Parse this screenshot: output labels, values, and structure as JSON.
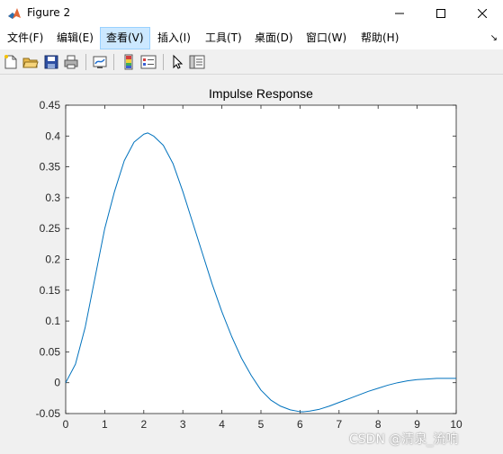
{
  "window": {
    "title": "Figure 2"
  },
  "menu": {
    "items": [
      {
        "label": "文件(F)"
      },
      {
        "label": "编辑(E)"
      },
      {
        "label": "查看(V)"
      },
      {
        "label": "插入(I)"
      },
      {
        "label": "工具(T)"
      },
      {
        "label": "桌面(D)"
      },
      {
        "label": "窗口(W)"
      },
      {
        "label": "帮助(H)"
      }
    ],
    "active_index": 2
  },
  "toolbar": {
    "icons": [
      "new-figure-icon",
      "open-file-icon",
      "save-icon",
      "print-icon",
      "link-plot-icon",
      "colorbar-icon",
      "legend-icon",
      "pointer-icon",
      "property-inspector-icon"
    ]
  },
  "colors": {
    "line": "#0072bd",
    "axes_bg": "#ffffff",
    "figure_bg": "#f0f0f0"
  },
  "watermark": "CSDN @清泉_流响",
  "chart_data": {
    "type": "line",
    "title": "Impulse Response",
    "xlabel": "",
    "ylabel": "",
    "xlim": [
      0,
      10
    ],
    "ylim": [
      -0.05,
      0.45
    ],
    "xticks": [
      "0",
      "1",
      "2",
      "3",
      "4",
      "5",
      "6",
      "7",
      "8",
      "9",
      "10"
    ],
    "yticks": [
      "-0.05",
      "0",
      "0.05",
      "0.1",
      "0.15",
      "0.2",
      "0.25",
      "0.3",
      "0.35",
      "0.4",
      "0.45"
    ],
    "grid": false,
    "series": [
      {
        "x": [
          0,
          0.25,
          0.5,
          0.75,
          1.0,
          1.25,
          1.5,
          1.75,
          2.0,
          2.1,
          2.25,
          2.5,
          2.75,
          3.0,
          3.25,
          3.5,
          3.75,
          4.0,
          4.25,
          4.5,
          4.75,
          5.0,
          5.25,
          5.5,
          5.75,
          6.0,
          6.1,
          6.25,
          6.5,
          6.75,
          7.0,
          7.25,
          7.5,
          7.75,
          8.0,
          8.25,
          8.5,
          8.75,
          9.0,
          9.25,
          9.5,
          9.75,
          10.0
        ],
        "y": [
          0,
          0.03,
          0.09,
          0.17,
          0.25,
          0.31,
          0.36,
          0.39,
          0.403,
          0.405,
          0.4,
          0.385,
          0.355,
          0.31,
          0.26,
          0.21,
          0.16,
          0.115,
          0.075,
          0.04,
          0.012,
          -0.012,
          -0.028,
          -0.038,
          -0.044,
          -0.047,
          -0.047,
          -0.046,
          -0.043,
          -0.038,
          -0.032,
          -0.026,
          -0.02,
          -0.014,
          -0.009,
          -0.004,
          0.0,
          0.003,
          0.005,
          0.006,
          0.007,
          0.007,
          0.007
        ]
      }
    ]
  }
}
